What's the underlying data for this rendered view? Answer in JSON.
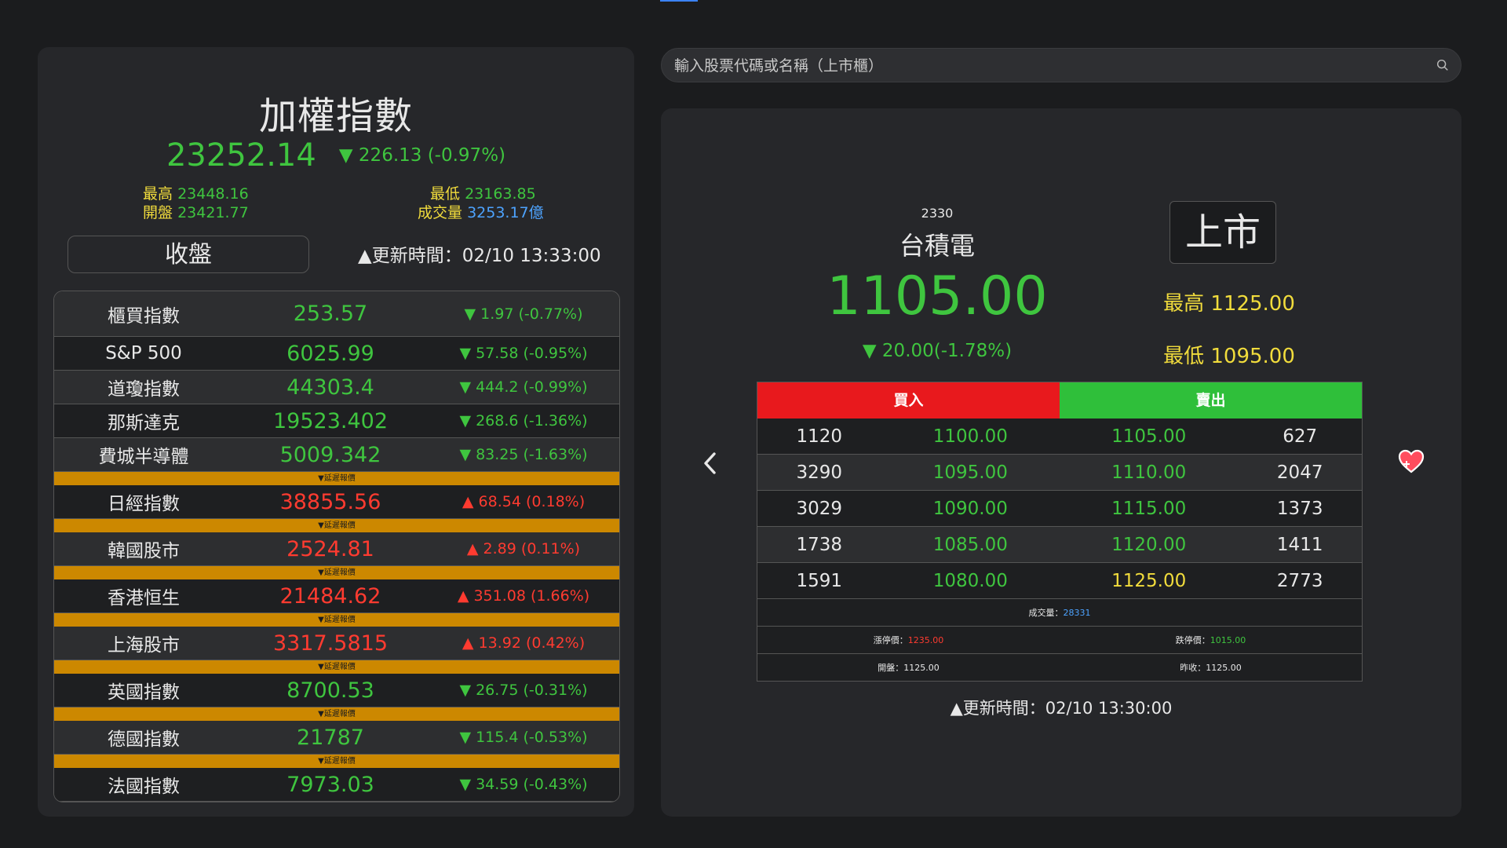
{
  "index": {
    "title": "加權指數",
    "price": "23252.14",
    "change": "▼ 226.13 (-0.97%)",
    "high_label": "最高",
    "high": "23448.16",
    "low_label": "最低",
    "low": "23163.85",
    "open_label": "開盤",
    "open": "23421.77",
    "volume_label": "成交量",
    "volume": "3253.17億",
    "status": "收盤",
    "update": "▲更新時間：02/10 13:33:00"
  },
  "delay_label": "▼延遲報價",
  "markets": [
    {
      "name": "櫃買指數",
      "value": "253.57",
      "change": "▼ 1.97 (-0.77%)"
    },
    {
      "name": "S&P 500",
      "value": "6025.99",
      "change": "▼ 57.58 (-0.95%)"
    },
    {
      "name": "道瓊指數",
      "value": "44303.4",
      "change": "▼ 444.2 (-0.99%)"
    },
    {
      "name": "那斯達克",
      "value": "19523.402",
      "change": "▼ 268.6 (-1.36%)"
    },
    {
      "name": "費城半導體",
      "value": "5009.342",
      "change": "▼ 83.25 (-1.63%)"
    },
    {
      "name": "日經指數",
      "value": "38855.56",
      "change": "▲ 68.54 (0.18%)"
    },
    {
      "name": "韓國股市",
      "value": "2524.81",
      "change": "▲ 2.89 (0.11%)"
    },
    {
      "name": "香港恒生",
      "value": "21484.62",
      "change": "▲ 351.08 (1.66%)"
    },
    {
      "name": "上海股市",
      "value": "3317.5815",
      "change": "▲ 13.92 (0.42%)"
    },
    {
      "name": "英國指數",
      "value": "8700.53",
      "change": "▼ 26.75 (-0.31%)"
    },
    {
      "name": "德國指數",
      "value": "21787",
      "change": "▼ 115.4 (-0.53%)"
    },
    {
      "name": "法國指數",
      "value": "7973.03",
      "change": "▼ 34.59 (-0.43%)"
    }
  ],
  "colors": {
    "up": "#ff3b30",
    "down": "#3fc53f",
    "delay": "#cc8800",
    "accent_yellow": "#f1dc3c"
  },
  "search": {
    "placeholder": "輸入股票代碼或名稱（上市櫃）"
  },
  "stock": {
    "code": "2330",
    "name": "台積電",
    "market": "上市",
    "price": "1105.00",
    "change": "▼ 20.00(-1.78%)",
    "high_label": "最高",
    "high": "1125.00",
    "low_label": "最低",
    "low": "1095.00",
    "update": "▲更新時間：02/10 13:30:00"
  },
  "orderbook": {
    "buy_label": "買入",
    "sell_label": "賣出",
    "rows": [
      {
        "bid_vol": "1120",
        "bid": "1100.00",
        "ask": "1105.00",
        "ask_vol": "627"
      },
      {
        "bid_vol": "3290",
        "bid": "1095.00",
        "ask": "1110.00",
        "ask_vol": "2047"
      },
      {
        "bid_vol": "3029",
        "bid": "1090.00",
        "ask": "1115.00",
        "ask_vol": "1373"
      },
      {
        "bid_vol": "1738",
        "bid": "1085.00",
        "ask": "1120.00",
        "ask_vol": "1411"
      },
      {
        "bid_vol": "1591",
        "bid": "1080.00",
        "ask": "1125.00",
        "ask_vol": "2773"
      }
    ],
    "volume_label": "成交量：",
    "volume": "28331",
    "limit_up_label": "漲停價：",
    "limit_up": "1235.00",
    "limit_down_label": "跌停價：",
    "limit_down": "1015.00",
    "open_label": "開盤：",
    "open": "1125.00",
    "prev_close_label": "昨收：",
    "prev_close": "1125.00"
  },
  "icons": {
    "prev": "chevron-left-icon",
    "favorite": "heart-plus-icon",
    "search": "search-icon"
  }
}
